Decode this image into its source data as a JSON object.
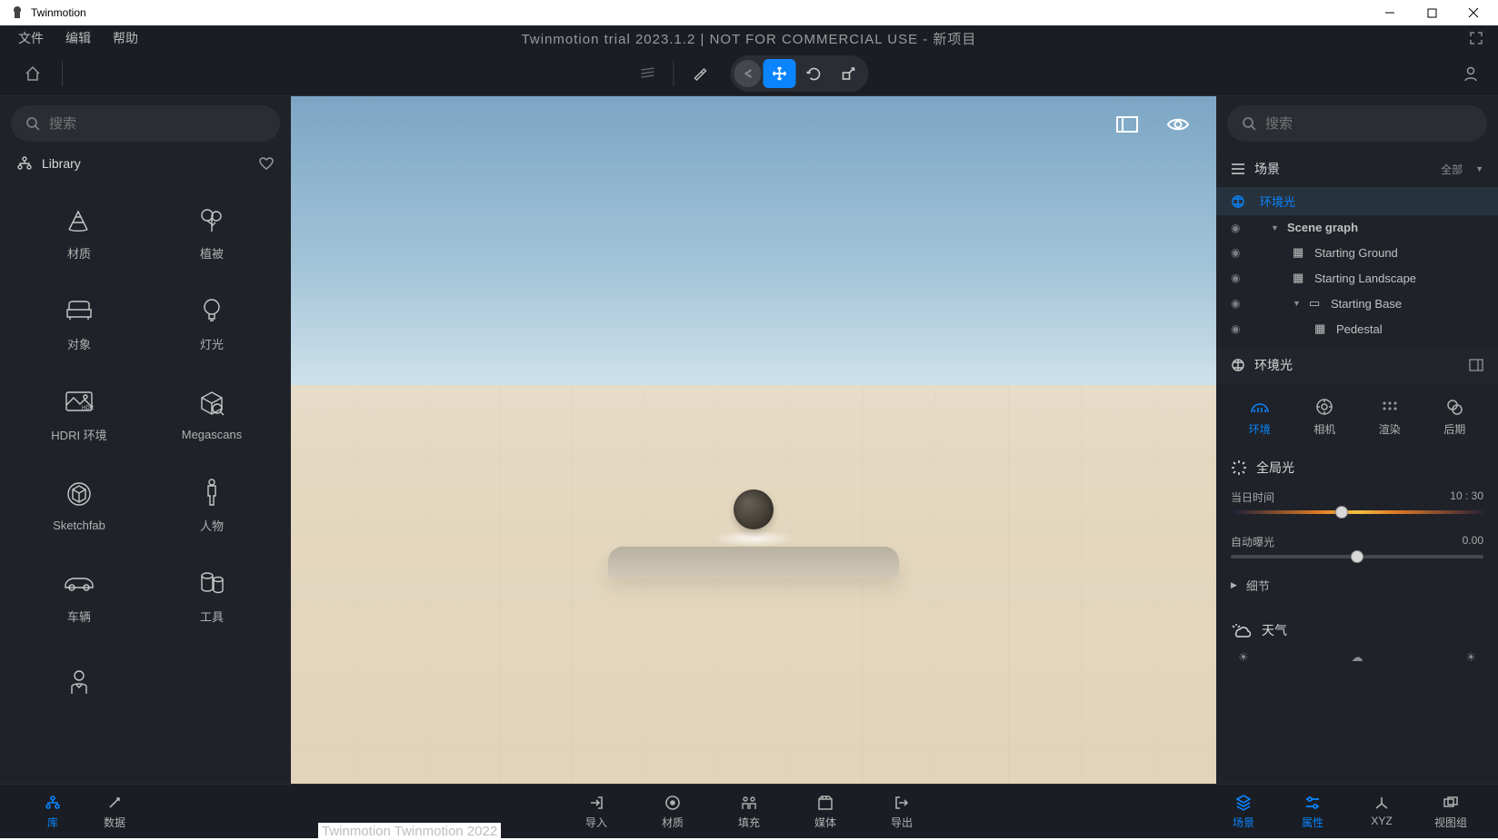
{
  "window": {
    "app_name": "Twinmotion"
  },
  "menu": {
    "file": "文件",
    "edit": "编辑",
    "help": "帮助",
    "title": "Twinmotion trial 2023.1.2 | NOT FOR COMMERCIAL USE - 新项目"
  },
  "search": {
    "placeholder": "搜索"
  },
  "library": {
    "title": "Library",
    "items": [
      {
        "label": "材质",
        "icon": "fan"
      },
      {
        "label": "植被",
        "icon": "tree"
      },
      {
        "label": "对象",
        "icon": "sofa"
      },
      {
        "label": "灯光",
        "icon": "bulb"
      },
      {
        "label": "HDRI 环境",
        "icon": "hdri"
      },
      {
        "label": "Megascans",
        "icon": "megascans"
      },
      {
        "label": "Sketchfab",
        "icon": "cube"
      },
      {
        "label": "人物",
        "icon": "person"
      },
      {
        "label": "车辆",
        "icon": "car"
      },
      {
        "label": "工具",
        "icon": "cyl"
      },
      {
        "label": "",
        "icon": "user"
      }
    ]
  },
  "scene": {
    "header": "场景",
    "filter": "全部",
    "env_light": "环境光",
    "nodes": {
      "scene_graph": "Scene graph",
      "ground": "Starting Ground",
      "landscape": "Starting Landscape",
      "base": "Starting Base",
      "pedestal": "Pedestal"
    }
  },
  "props": {
    "section_title": "环境光",
    "tabs": {
      "env": "环境",
      "camera": "相机",
      "render": "渲染",
      "post": "后期"
    },
    "global": "全局光",
    "time_label": "当日时间",
    "time_value": "10 : 30",
    "time_pct": 44,
    "exposure_label": "自动曝光",
    "exposure_value": "0.00",
    "exposure_pct": 50,
    "details": "细节",
    "weather": "天气"
  },
  "bottom": {
    "left": {
      "lib": "库",
      "data": "数据"
    },
    "center": {
      "import": "导入",
      "material": "材质",
      "fill": "填充",
      "media": "媒体",
      "export": "导出"
    },
    "right": {
      "scene": "场景",
      "props": "属性",
      "xyz": "XYZ",
      "viewset": "视图组"
    }
  },
  "footer_scrap": "Twinmotion    Twinmotion 2022"
}
